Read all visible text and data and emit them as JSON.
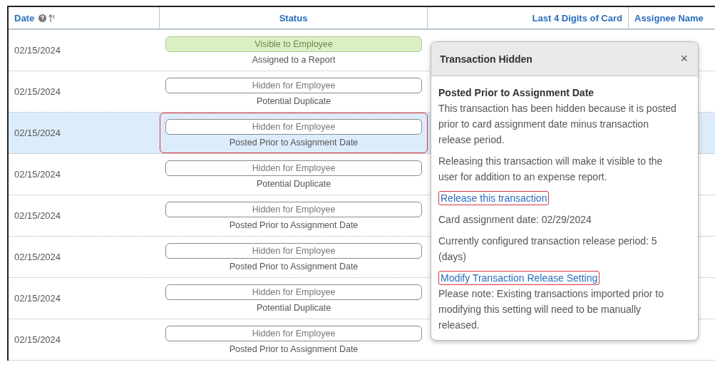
{
  "table": {
    "columns": [
      {
        "label": "Date",
        "kind": "date"
      },
      {
        "label": "Status",
        "kind": "status"
      },
      {
        "label": "Last 4 Digits of Card",
        "kind": "card"
      },
      {
        "label": "Assignee Name",
        "kind": "assignee"
      }
    ],
    "rows": [
      {
        "date": "02/15/2024",
        "status": "Visible to Employee",
        "visible": true,
        "reason": "Assigned to a Report",
        "selected": false,
        "highlighted": false
      },
      {
        "date": "02/15/2024",
        "status": "Hidden for Employee",
        "visible": false,
        "reason": "Potential Duplicate",
        "selected": false,
        "highlighted": false
      },
      {
        "date": "02/15/2024",
        "status": "Hidden for Employee",
        "visible": false,
        "reason": "Posted Prior to Assignment Date",
        "selected": true,
        "highlighted": true
      },
      {
        "date": "02/15/2024",
        "status": "Hidden for Employee",
        "visible": false,
        "reason": "Potential Duplicate",
        "selected": false,
        "highlighted": false
      },
      {
        "date": "02/15/2024",
        "status": "Hidden for Employee",
        "visible": false,
        "reason": "Posted Prior to Assignment Date",
        "selected": false,
        "highlighted": false
      },
      {
        "date": "02/15/2024",
        "status": "Hidden for Employee",
        "visible": false,
        "reason": "Posted Prior to Assignment Date",
        "selected": false,
        "highlighted": false
      },
      {
        "date": "02/15/2024",
        "status": "Hidden for Employee",
        "visible": false,
        "reason": "Potential Duplicate",
        "selected": false,
        "highlighted": false
      },
      {
        "date": "02/15/2024",
        "status": "Hidden for Employee",
        "visible": false,
        "reason": "Posted Prior to Assignment Date",
        "selected": false,
        "highlighted": false
      }
    ]
  },
  "popover": {
    "title": "Transaction Hidden",
    "close": "×",
    "blocks": [
      {
        "kind": "heading",
        "text": "Posted Prior to Assignment Date"
      },
      {
        "kind": "subtext",
        "text": "This transaction has been hidden because it is posted prior to card assignment date minus transaction release period."
      },
      {
        "kind": "text",
        "text": "Releasing this transaction will make it visible to the user for addition to an expense report."
      },
      {
        "kind": "link",
        "text": "Release this transaction",
        "highlighted": true
      },
      {
        "kind": "text",
        "text": "Card assignment date: 02/29/2024"
      },
      {
        "kind": "text",
        "text": "Currently configured transaction release period: 5 (days)"
      },
      {
        "kind": "link",
        "text": "Modify Transaction Release Setting",
        "highlighted": true
      },
      {
        "kind": "subtext",
        "text": "Please note: Existing transactions imported prior to modifying this setting will need to be manually released."
      }
    ]
  }
}
